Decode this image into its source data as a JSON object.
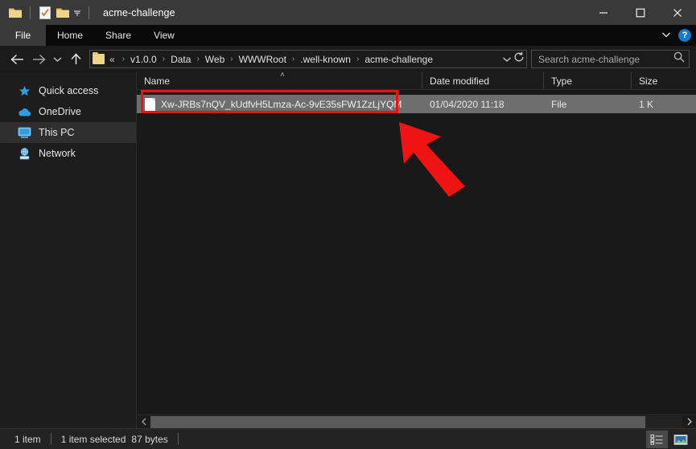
{
  "window": {
    "title": "acme-challenge",
    "quick_access": [
      "folder-icon",
      "properties-icon",
      "new-folder-icon"
    ],
    "controls": {
      "minimize": "–",
      "maximize": "☐",
      "close": "✕"
    }
  },
  "ribbon": {
    "tabs": [
      {
        "label": "File",
        "active": true
      },
      {
        "label": "Home",
        "active": false
      },
      {
        "label": "Share",
        "active": false
      },
      {
        "label": "View",
        "active": false
      }
    ],
    "help_label": "?"
  },
  "addressbar": {
    "back": "←",
    "forward": "→",
    "recent": "⌄",
    "up": "↑",
    "lead": "«",
    "crumbs": [
      "v1.0.0",
      "Data",
      "Web",
      "WWWRoot",
      ".well-known",
      "acme-challenge"
    ],
    "separator": "›",
    "dropdown": "⌄",
    "refresh": "↻"
  },
  "search": {
    "placeholder": "Search acme-challenge",
    "icon": "search-icon"
  },
  "sidebar": {
    "items": [
      {
        "label": "Quick access",
        "icon": "star-icon",
        "selected": false
      },
      {
        "label": "OneDrive",
        "icon": "cloud-icon",
        "selected": false
      },
      {
        "label": "This PC",
        "icon": "monitor-icon",
        "selected": true
      },
      {
        "label": "Network",
        "icon": "network-icon",
        "selected": false
      }
    ]
  },
  "filelist": {
    "columns": [
      {
        "label": "Name",
        "sorted": "ascending"
      },
      {
        "label": "Date modified",
        "sorted": ""
      },
      {
        "label": "Type",
        "sorted": ""
      },
      {
        "label": "Size",
        "sorted": ""
      }
    ],
    "sort_caret": "˄",
    "rows": [
      {
        "name": "Xw-JRBs7nQV_kUdfvH5Lmza-Ac-9vE35sFW1ZzLjYQM",
        "date_modified": "01/04/2020 11:18",
        "type": "File",
        "size": "1 K",
        "selected": true,
        "icon": "file-icon"
      }
    ]
  },
  "annotations": {
    "highlight_color": "#ee1111",
    "arrow_color": "#ef1313"
  },
  "scrollbar": {
    "left": "‹",
    "right": "›"
  },
  "statusbar": {
    "item_count": "1 item",
    "selection": "1 item selected",
    "selection_size": "87 bytes",
    "views": [
      {
        "name": "details-view",
        "active": true
      },
      {
        "name": "large-icons-view",
        "active": false
      }
    ]
  }
}
